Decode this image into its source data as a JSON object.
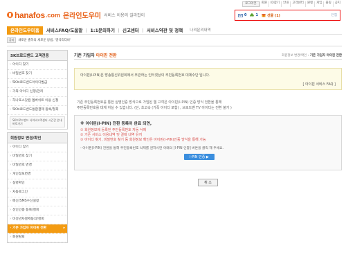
{
  "top_links": [
    "로그아웃",
    "회원",
    "ID찾기",
    "안내",
    "고객센터",
    "원랭",
    "게임",
    "블링",
    "공지"
  ],
  "logo": {
    "brand": "hanafos",
    "dotcom": ".com",
    "kr": "온라인도우미",
    "tagline": "서비스 이용의 길라잡이"
  },
  "userbox": {
    "mail_count": "0",
    "points_count": "1",
    "gift_label": "선물 (1)",
    "end_label": "닫힘"
  },
  "nav": {
    "items": [
      {
        "label": "온라인도우미홈"
      },
      {
        "label": "서비스FAQ/도움말"
      },
      {
        "label": "1:1문의하기"
      },
      {
        "label": "신고센터"
      },
      {
        "label": "서비스약관 및 정책"
      },
      {
        "label": "나의문의내역"
      }
    ]
  },
  "ticker": {
    "badge": "공지",
    "text": "새로운 출하의 새로운 방법, '영국리더바'"
  },
  "sidebar": {
    "section1_title": "SK브로드밴드 고객전용",
    "section1_items": [
      "아이디 찾기",
      "비밀번호 찾기",
      "SK브로드밴드아이디발급",
      "가족 아이디 신청/관리",
      "하나포스닷컴 멤버쉬트 이용 신청",
      "SK브로드밴드통합결제 등록/철회"
    ],
    "banner": "SK브로드밴드 사이버고객센터 시간간 안내 바로가기",
    "section2_title": "회원정보 변경/확인",
    "section2_items": [
      "아이디 찾기",
      "비밀번호 찾기",
      "비밀번호 변경",
      "개인정보변경",
      "실명확인",
      "자동로그인",
      "메신/SMS수신설정",
      "성인인증 등록/철회",
      "미성년자결제동의/철회",
      "기존 가입자 아이핀 전환",
      "회원탈퇴"
    ],
    "active_index": 9
  },
  "content": {
    "title_prefix": "기존 가입자",
    "title_highlight": "아이핀 전환",
    "breadcrumb": "회원정보 변경/확인 ›",
    "breadcrumb_current": "기존 가입자 아이핀 전환",
    "info_text": "아이핀(I-PIN)은 방송통신위원회에서 주관하는 인터넷상의 주민등록번호 대체수단 입니다.",
    "info_faq": "[ 아이핀 서비스 FAQ ]",
    "desc_line1": "기존 주민등록번호를 통한 실명인증 방식으로 가입된 웹 고객은 아이핀(I-PIN) 인증 방식 전환을 통해",
    "desc_line2": "주민등록번호를 대체 하실 수 있습니다. (단, 초고속 (가족 아이디 포함) , 브로드밴 TV 아이디는 전환 불가 )",
    "notice_title": "※ 아이핀(I-PIN) 전환 등록이 완료 되면,",
    "notice_items": [
      "① 회원정보에 등록된 주민등록번호 자동 삭제",
      "② 기존 서비스 이용내역  및 결제 내역 유지",
      "③ 아이디 찾기, 비밀번호 찾기 등 회원정보 확인은 아이핀(I-PIN)인증 방식을 통해 가능"
    ],
    "notice_foot": "- 아이핀(I-PIN) 전환을 통해 주민등록번호 삭제를 원하시면 아래의 [I-PIN 인증] 버튼을 클릭 해 주세요.",
    "ipin_button": "I-PIN 인증  ▶",
    "cancel_button": "취 소"
  }
}
